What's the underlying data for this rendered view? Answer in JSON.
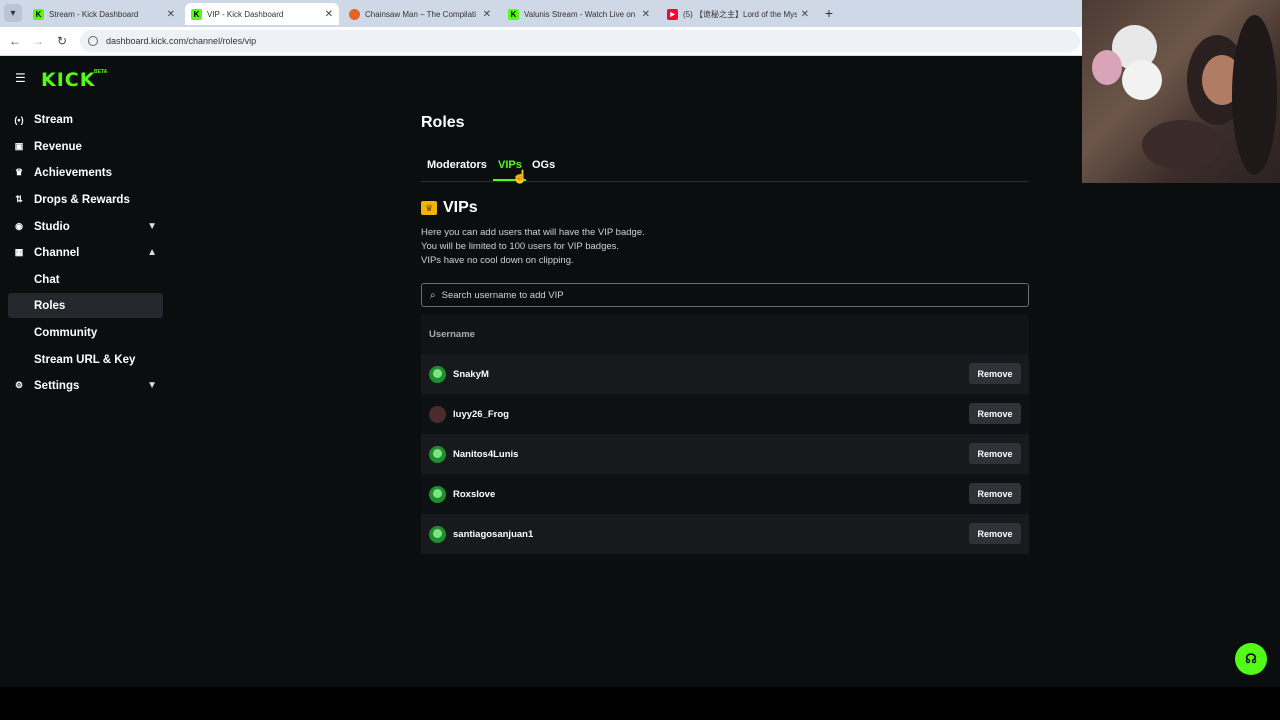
{
  "browser": {
    "tabs": [
      {
        "title": "Stream - Kick Dashboard",
        "favicon": "kick-icon",
        "active": false
      },
      {
        "title": "VIP - Kick Dashboard",
        "favicon": "kick-icon",
        "active": true
      },
      {
        "title": "Chainsaw Man – The Compilati",
        "favicon": "globe-icon",
        "active": false
      },
      {
        "title": "Valunis Stream - Watch Live on",
        "favicon": "kick-icon",
        "active": false
      },
      {
        "title": "(5) 【诡秘之主】Lord of the Myst",
        "favicon": "youtube-icon",
        "active": false
      }
    ],
    "url": "dashboard.kick.com/channel/roles/vip"
  },
  "sidebar": {
    "logo": "KICK",
    "logo_badge": "BETA",
    "items": [
      {
        "label": "Stream",
        "icon": "broadcast-icon"
      },
      {
        "label": "Revenue",
        "icon": "chart-icon"
      },
      {
        "label": "Achievements",
        "icon": "trophy-icon"
      },
      {
        "label": "Drops & Rewards",
        "icon": "drops-icon"
      },
      {
        "label": "Studio",
        "icon": "studio-icon"
      },
      {
        "label": "Channel",
        "icon": "channel-icon"
      },
      {
        "label": "Chat"
      },
      {
        "label": "Roles"
      },
      {
        "label": "Community"
      },
      {
        "label": "Stream URL & Key"
      },
      {
        "label": "Settings",
        "icon": "gear-icon"
      }
    ]
  },
  "main": {
    "title": "Roles",
    "tabs": [
      {
        "label": "Moderators"
      },
      {
        "label": "VIPs"
      },
      {
        "label": "OGs"
      }
    ],
    "section_title": "VIPs",
    "description": [
      "Here you can add users that will have the VIP badge.",
      "You will be limited to 100 users for VIP badges.",
      "VIPs have no cool down on clipping."
    ],
    "search_placeholder": "Search username to add VIP",
    "table_header": "Username",
    "remove_label": "Remove",
    "users": [
      {
        "username": "SnakyM"
      },
      {
        "username": "luyy26_Frog"
      },
      {
        "username": "Nanitos4Lunis"
      },
      {
        "username": "Roxslove"
      },
      {
        "username": "santiagosanjuan1"
      }
    ]
  },
  "colors": {
    "accent": "#53fc18",
    "background": "#0b0e0f",
    "crown": "#f5b400"
  }
}
